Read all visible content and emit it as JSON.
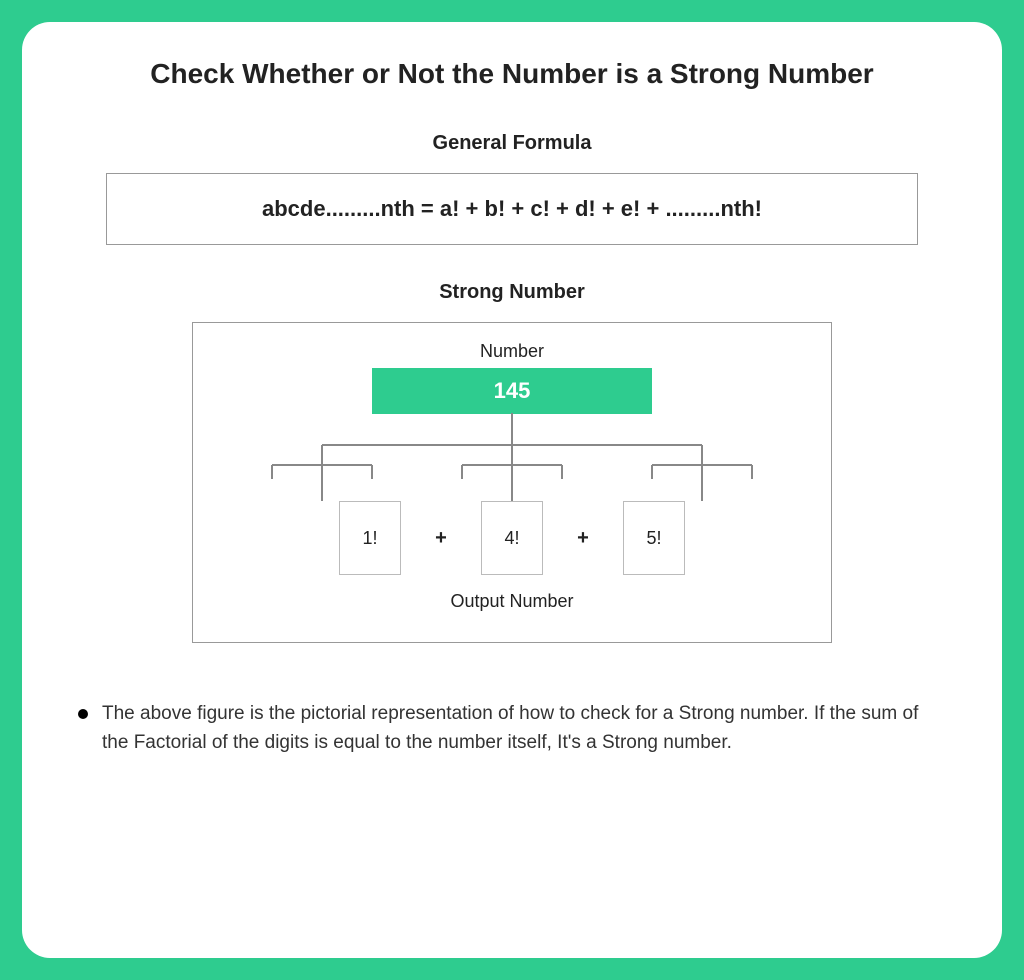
{
  "title": "Check Whether or Not the Number is a Strong Number",
  "formula": {
    "heading": "General Formula",
    "text": "abcde.........nth = a! + b! + c! + d! + e! + .........nth!"
  },
  "strong": {
    "heading": "Strong Number",
    "number_label": "Number",
    "number_value": "145",
    "digits": [
      "1!",
      "4!",
      "5!"
    ],
    "plus": "+",
    "output_label": "Output Number"
  },
  "note": "The above figure is the pictorial representation of how to check for a Strong number. If the sum of the Factorial of the digits is equal to the number itself, It's a Strong number."
}
